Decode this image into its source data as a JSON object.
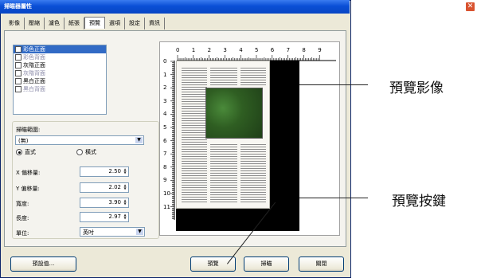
{
  "window": {
    "title": "掃瞄器屬性",
    "close_glyph": "✕",
    "tabs": [
      "影像",
      "壓縮",
      "濾色",
      "紙張",
      "預覽",
      "選項",
      "設定",
      "資訊"
    ],
    "active_tab": "預覽"
  },
  "image_list": [
    {
      "label": "彩色正面",
      "checked": true,
      "selected": true
    },
    {
      "label": "彩色背面",
      "checked": false,
      "dim": true
    },
    {
      "label": "灰階正面",
      "checked": false
    },
    {
      "label": "灰階背面",
      "checked": false,
      "dim": true
    },
    {
      "label": "黑白正面",
      "checked": false
    },
    {
      "label": "黑白背面",
      "checked": false,
      "dim": true
    }
  ],
  "scan_area": {
    "label": "掃瞄範圍:",
    "value": "(無)",
    "portrait_label": "直式",
    "landscape_label": "橫式",
    "orientation": "portrait"
  },
  "fields": {
    "x_offset": {
      "label": "X 偏移量:",
      "value": "2.50"
    },
    "y_offset": {
      "label": "Y 偏移量:",
      "value": "2.02"
    },
    "width": {
      "label": "寬度:",
      "value": "3.90"
    },
    "length": {
      "label": "長度:",
      "value": "2.97"
    },
    "unit": {
      "label": "單位:",
      "value": "英吋"
    }
  },
  "ruler": {
    "top": [
      "0",
      "1",
      "2",
      "3",
      "4",
      "5",
      "6",
      "7",
      "8",
      "9"
    ],
    "left": [
      "0",
      "1",
      "2",
      "3",
      "4",
      "5",
      "6",
      "7",
      "8",
      "9",
      "10",
      "11"
    ]
  },
  "buttons": {
    "defaults": "預設值...",
    "preview": "預覽",
    "scan": "掃瞄",
    "close": "關閉"
  },
  "callouts": {
    "preview_image": "預覽影像",
    "preview_button": "預覽按鍵"
  },
  "colors": {
    "titlebar": "#0a4fd6",
    "selection": "#316ac5",
    "window_face": "#ece9d8"
  }
}
